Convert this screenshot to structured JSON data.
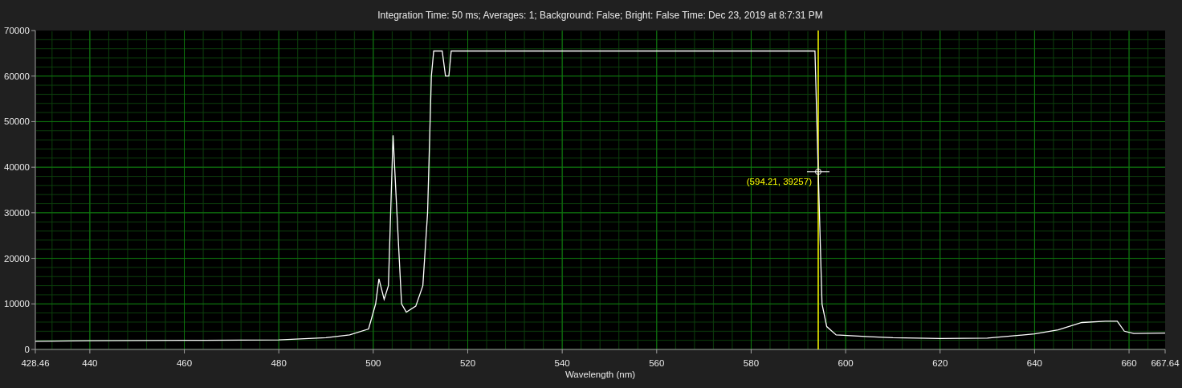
{
  "chart_data": {
    "type": "line",
    "title": "Integration Time: 50 ms; Averages: 1; Background: False; Bright: False Time: Dec 23, 2019 at 8:7:31 PM",
    "xlabel": "Wavelength (nm)",
    "x": [
      428.46,
      440,
      460,
      480,
      490,
      495,
      499,
      500.5,
      501.2,
      502.3,
      503.2,
      504.2,
      505,
      506,
      507,
      509,
      510.5,
      511.5,
      512.3,
      512.8,
      514.6,
      515.3,
      516,
      516.5,
      520,
      540,
      560,
      580,
      593.5,
      594.2,
      595,
      596,
      598,
      605,
      610,
      620,
      630,
      640,
      645,
      650,
      655,
      657.5,
      659,
      661,
      667.64
    ],
    "series": [
      {
        "color": "#ffffff",
        "values": [
          1800,
          1900,
          2000,
          2100,
          2600,
          3200,
          4500,
          10000,
          15500,
          11000,
          14000,
          47000,
          30000,
          10000,
          8200,
          9500,
          14000,
          30000,
          60000,
          65500,
          65500,
          60000,
          60000,
          65500,
          65500,
          65500,
          65500,
          65500,
          65500,
          39000,
          10000,
          5000,
          3200,
          2800,
          2600,
          2400,
          2500,
          3400,
          4300,
          5900,
          6200,
          6200,
          4000,
          3500,
          3600
        ]
      }
    ],
    "xlim": [
      428.46,
      667.64
    ],
    "ylim": [
      0,
      70000
    ],
    "xticks": [
      {
        "value": 428.46,
        "label": "428.46"
      },
      440,
      460,
      480,
      500,
      520,
      540,
      560,
      580,
      600,
      620,
      640,
      660,
      {
        "value": 667.64,
        "label": "667.64"
      }
    ],
    "yticks": [
      0,
      10000,
      20000,
      30000,
      40000,
      50000,
      60000,
      70000
    ],
    "grid": true,
    "ref_lines": [
      {
        "axis": "x",
        "value": 594.2,
        "color": "#ffff00"
      }
    ],
    "annotations": [
      {
        "text": "(594.21, 39257)",
        "x": 594.2,
        "y": 39000
      }
    ]
  }
}
